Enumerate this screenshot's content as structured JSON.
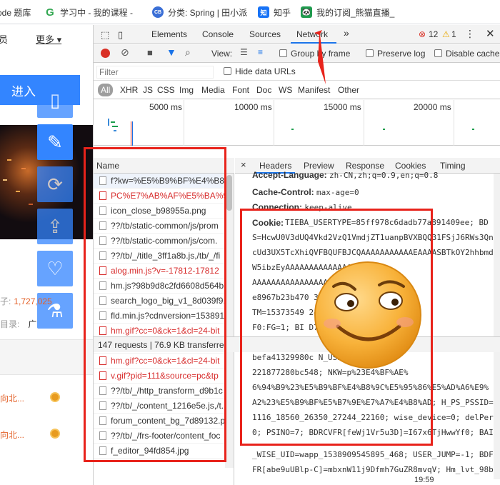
{
  "bookmarks": [
    {
      "label": "ode 题库",
      "icon": "",
      "color": "#ffffff"
    },
    {
      "label": "学习中 - 我的课程 - ",
      "icon": "G",
      "color": "#34a853"
    },
    {
      "label": "分类: Spring | 田小派",
      "icon": "CB",
      "color": "#3b6fd6"
    },
    {
      "label": "知乎",
      "icon": "知",
      "color": "#1772f6"
    },
    {
      "label": "我的订阅_熊猫直播_",
      "icon": "🐼",
      "color": "#1f9b4e"
    }
  ],
  "page": {
    "nav": [
      "员",
      "更多"
    ],
    "login_label": "进入",
    "stats": [
      {
        "label": "子:",
        "value": "1,727,025"
      },
      {
        "label": "目录:",
        "value": "广"
      }
    ],
    "feed": [
      "向北...",
      "向北..."
    ]
  },
  "devtools": {
    "tabs": [
      "Elements",
      "Console",
      "Sources",
      "Network"
    ],
    "more_label": "»",
    "errors": "12",
    "warnings": "1",
    "toolbar": {
      "view_label": "View:",
      "group_by_frame": "Group by frame",
      "preserve_log": "Preserve log",
      "disable_cache": "Disable cache"
    },
    "filter": {
      "placeholder": "Filter",
      "hide_data_urls": "Hide data URLs"
    },
    "types": [
      "All",
      "XHR",
      "JS",
      "CSS",
      "Img",
      "Media",
      "Font",
      "Doc",
      "WS",
      "Manifest",
      "Other"
    ],
    "timeline_ticks": [
      "5000 ms",
      "10000 ms",
      "15000 ms",
      "20000 ms"
    ],
    "name_header": "Name",
    "requests": [
      {
        "name": "f?kw=%E5%B9%BF%E4%B8%",
        "red": false
      },
      {
        "name": "PC%E7%AB%AF%E5%BA%95.",
        "red": true
      },
      {
        "name": "icon_close_b98955a.png",
        "red": false
      },
      {
        "name": "??/tb/static-common/js/prom",
        "red": false
      },
      {
        "name": "??/tb/static-common/js/com.",
        "red": false
      },
      {
        "name": "??/tb/_/title_3ff1a8b.js,/tb/_/fi",
        "red": false
      },
      {
        "name": "alog.min.js?v=-17812-17812",
        "red": true
      },
      {
        "name": "hm.js?98b9d8c2fd6608d564b",
        "red": false
      },
      {
        "name": "search_logo_big_v1_8d039f9.p",
        "red": false
      },
      {
        "name": "fld.min.js?cdnversion=153891",
        "red": false
      },
      {
        "name": "hm.gif?cc=0&ck=1&cl=24-bit",
        "red": true
      },
      {
        "name": "hm.gif?kb=2&cc=0&ck=1&cl",
        "red": true
      },
      {
        "name": "hm.gif?cc=0&ck=1&cl=24-bit",
        "red": true
      },
      {
        "name": "v.gif?pid=111&source=pc&tp",
        "red": true
      },
      {
        "name": "??/tb/_/http_transform_d9b1c",
        "red": false
      },
      {
        "name": "??/tb/_/content_1216e5e.js,/t.",
        "red": false
      },
      {
        "name": "forum_content_bg_7d89132.p",
        "red": false
      },
      {
        "name": "??/tb/_/frs-footer/content_foc",
        "red": false
      },
      {
        "name": "f_editor_94fd854.jpg",
        "red": false
      }
    ],
    "status": "147 requests | 76.9 KB transferre",
    "detail_tabs": [
      "×",
      "Headers",
      "Preview",
      "Response",
      "Cookies",
      "Timing"
    ],
    "headers_top": [
      {
        "k": "Accept-Language:",
        "v": "zh-CN,zh;q=0.9,en;q=0.8"
      },
      {
        "k": "Cache-Control:",
        "v": "max-age=0"
      },
      {
        "k": "Connection:",
        "v": "keep-alive"
      }
    ],
    "cookie_label": "Cookie:",
    "cookie_lines": [
      "TIEBA_USERTYPE=85ff978c6dadb77a891409ee; BD",
      "S=HcwU0V3dUQ4Vkd2VzQ1VmdjZT1uanpBVXBQQ31FSjJ6RWs3Qn",
      "cUd3UX5TcXhiQVFBQUFBJCQAAAAAAAAAAAEAAAASBTkOY2hhbmd",
      "W5ibzEyAAAAAAAAAAAAAA",
      "AAAAAAAAAAAAAAAA                 TIEBAUID=898e9",
      "e8967b23b470                      35425866642;",
      "TM=15373549                       240253D11858",
      "F0:FG=1; BI                       D7D35DBC0D9",
      "CITY=-%3A; S                      a812685719f",
      "befa41329980c                     N_USER=4a22c8f",
      "221877280bc548;                   NKW=p%23E4%BF%AE%",
      "6%94%B9%23%E5%B9%BF%E4%B8%9C%E5%95%86%E5%AD%A6%E9%",
      "A2%23%E5%B9%BF%E5%B7%9E%E7%A7%E4%B8%AD; H_PS_PSSID=146",
      "1116_18560_26350_27244_22160; wise_device=0; delPer",
      "0; PSINO=7; BDRCVFR[feWj1Vr5u3D]=I67x6TjHwwYf0; BAI"
    ],
    "cookie_tail": [
      "_WISE_UID=wapp_1538909545895_468; USER_JUMP=-1; BDF",
      "FR[abe9uUBlp-C]=mbxnW11j9Dfmh7GuZR8mvqV; Hm_lvt_98b"
    ]
  },
  "clock": "19:59"
}
